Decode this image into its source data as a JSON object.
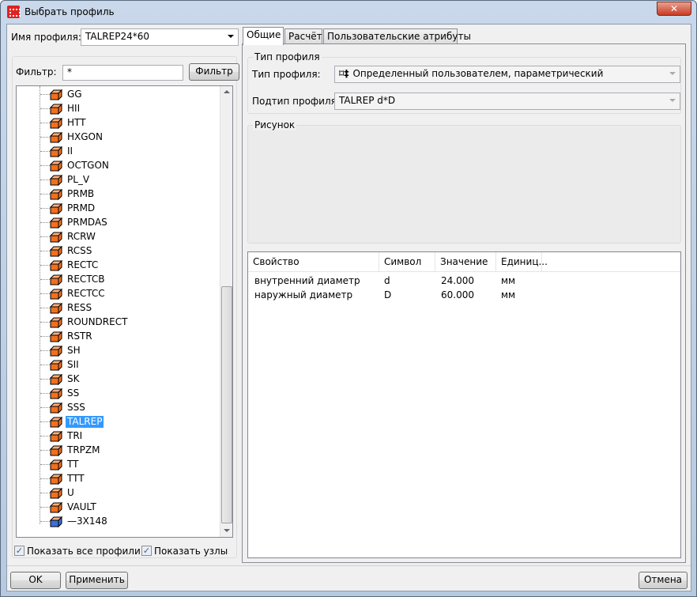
{
  "window": {
    "title": "Выбрать профиль",
    "close": "✕"
  },
  "left": {
    "profile_name_label": "Имя профиля:",
    "profile_name_value": "TALREP24*60",
    "filter_label": "Фильтр:",
    "filter_value": "*",
    "filter_button": "Фильтр",
    "tree_items": [
      {
        "label": "GG",
        "kind": "orange"
      },
      {
        "label": "HII",
        "kind": "orange"
      },
      {
        "label": "HTT",
        "kind": "orange"
      },
      {
        "label": "HXGON",
        "kind": "orange"
      },
      {
        "label": "II",
        "kind": "orange"
      },
      {
        "label": "OCTGON",
        "kind": "orange"
      },
      {
        "label": "PL_V",
        "kind": "orange"
      },
      {
        "label": "PRMB",
        "kind": "orange"
      },
      {
        "label": "PRMD",
        "kind": "orange"
      },
      {
        "label": "PRMDAS",
        "kind": "orange"
      },
      {
        "label": "RCRW",
        "kind": "orange"
      },
      {
        "label": "RCSS",
        "kind": "orange"
      },
      {
        "label": "RECTC",
        "kind": "orange"
      },
      {
        "label": "RECTCB",
        "kind": "orange"
      },
      {
        "label": "RECTCC",
        "kind": "orange"
      },
      {
        "label": "RESS",
        "kind": "orange"
      },
      {
        "label": "ROUNDRECT",
        "kind": "orange"
      },
      {
        "label": "RSTR",
        "kind": "orange"
      },
      {
        "label": "SH",
        "kind": "orange"
      },
      {
        "label": "SII",
        "kind": "orange"
      },
      {
        "label": "SK",
        "kind": "orange"
      },
      {
        "label": "SS",
        "kind": "orange"
      },
      {
        "label": "SSS",
        "kind": "orange"
      },
      {
        "label": "TALREP",
        "kind": "orange",
        "selected": true
      },
      {
        "label": "TRI",
        "kind": "orange"
      },
      {
        "label": "TRPZM",
        "kind": "orange"
      },
      {
        "label": "TT",
        "kind": "orange"
      },
      {
        "label": "TTT",
        "kind": "orange"
      },
      {
        "label": "U",
        "kind": "orange"
      },
      {
        "label": "VAULT",
        "kind": "orange"
      },
      {
        "label": "—3X148",
        "kind": "blue"
      }
    ],
    "show_all_profiles": {
      "label": "Показать все профили",
      "checked": true
    },
    "show_nodes": {
      "label": "Показать узлы",
      "checked": true
    }
  },
  "tabs": [
    "Общие",
    "Расчёт",
    "Пользовательские атрибуты"
  ],
  "general": {
    "type_group": "Тип профиля",
    "type_label": "Тип профиля:",
    "type_value": "Определенный пользователем, параметрический",
    "subtype_label": "Подтип профиля:",
    "subtype_value": "TALREP d*D",
    "picture_group": "Рисунок"
  },
  "table": {
    "columns": [
      "Свойство",
      "Символ",
      "Значение",
      "Единиц..."
    ],
    "rows": [
      [
        "внутренний диаметр",
        "d",
        "24.000",
        "мм"
      ],
      [
        "наружный диаметр",
        "D",
        "60.000",
        "мм"
      ]
    ]
  },
  "buttons": {
    "ok": "OK",
    "apply": "Применить",
    "cancel": "Отмена"
  },
  "colors": {
    "selection": "#3399ff",
    "orange_cube": "#f07020",
    "blue_cube": "#3b6fd8"
  }
}
